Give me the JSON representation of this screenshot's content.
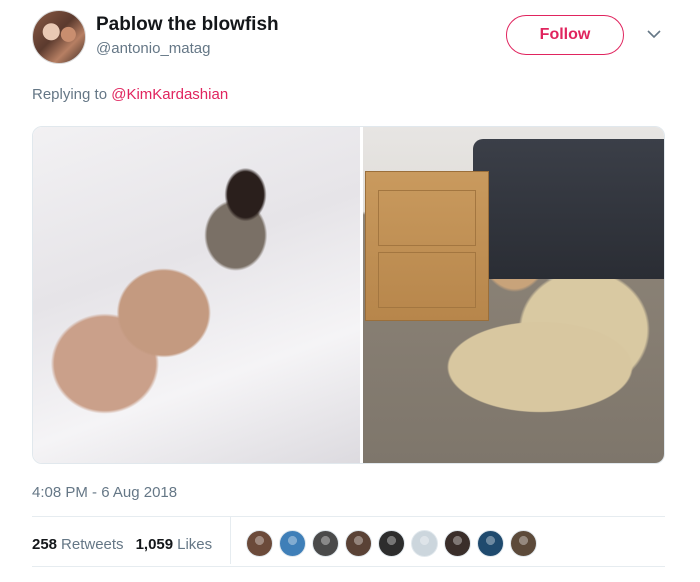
{
  "tweet": {
    "display_name": "Pablow the blowfish",
    "handle": "@antonio_matag",
    "follow_label": "Follow",
    "replying_prefix": "Replying to ",
    "replying_mention": "@KimKardashian",
    "timestamp": "4:08 PM - 6 Aug 2018",
    "retweets_count": "258",
    "retweets_label": "Retweets",
    "likes_count": "1,059",
    "likes_label": "Likes"
  },
  "colors": {
    "accent": "#e0245e",
    "secondary_text": "#657786",
    "primary_text": "#14171a"
  },
  "icons": {
    "more": "chevron-down-icon"
  },
  "liker_avatars": [
    {
      "name": "liker-avatar",
      "color": "#6b4a3a"
    },
    {
      "name": "liker-avatar",
      "color": "#3f7fb8"
    },
    {
      "name": "liker-avatar",
      "color": "#4a4a4a"
    },
    {
      "name": "liker-avatar",
      "color": "#5a4236"
    },
    {
      "name": "liker-avatar",
      "color": "#2d2d2d"
    },
    {
      "name": "liker-avatar",
      "color": "#ccd6dd"
    },
    {
      "name": "liker-avatar",
      "color": "#3a2e2a"
    },
    {
      "name": "liker-avatar",
      "color": "#1f4a6e"
    },
    {
      "name": "liker-avatar",
      "color": "#5c4a3a"
    }
  ]
}
